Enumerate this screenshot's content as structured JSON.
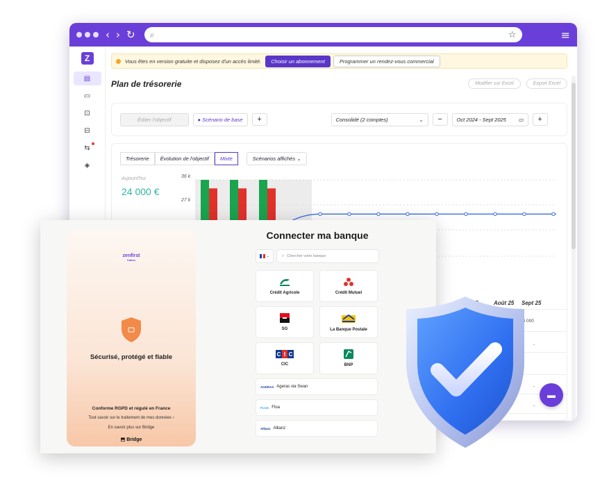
{
  "browser": {
    "url": "",
    "search_icon": "search-icon",
    "back_icon": "chevron-left-icon",
    "forward_icon": "chevron-right-icon",
    "reload_icon": "reload-icon",
    "star_icon": "star-icon",
    "menu_icon": "hamburger-icon"
  },
  "app": {
    "logo": "Z",
    "sidebar": [
      {
        "icon": "table-icon",
        "glyph": "▤",
        "active": true
      },
      {
        "icon": "calendar-icon",
        "glyph": "▭",
        "active": false
      },
      {
        "icon": "document-add-icon",
        "glyph": "⊡",
        "active": false
      },
      {
        "icon": "document-icon",
        "glyph": "⊟",
        "active": false
      },
      {
        "icon": "transfer-icon",
        "glyph": "⇆",
        "active": false,
        "badge": true
      },
      {
        "icon": "tag-icon",
        "glyph": "◈",
        "active": false
      }
    ],
    "banner": {
      "text": "Vous êtes en version gratuite et disposez d'un accès limité.",
      "cta_primary": "Choisir un abonnement",
      "cta_secondary": "Programmer un rendez-vous commercial"
    },
    "page_title": "Plan de trésorerie",
    "head_buttons": [
      "Modifier sur Excel",
      "Export Excel"
    ],
    "toolbar": {
      "edit_goal": "Éditer l'objectif",
      "scenario": "Scénario de base",
      "add": "+",
      "consolidated": "Consolidé (2 comptes)",
      "minus": "−",
      "period": "Oct 2024 - Sept 2025",
      "plus": "+"
    },
    "chart": {
      "tabs": [
        "Trésorerie",
        "Évolution de l'objectif",
        "Mixte"
      ],
      "active_tab": "Mixte",
      "scenarios_dropdown": "Scénarios affichés",
      "today_label": "Aujourd'hui",
      "today_value": "24 000 €",
      "y_ticks": [
        "36 k",
        "27 k"
      ],
      "months_visible": [
        "25",
        "il 25",
        "Août 25",
        "Sept 25"
      ],
      "table_value": "24 000",
      "table_dash": "-",
      "colors": {
        "green": "#1aa44f",
        "red": "#e0312b",
        "line": "#3b6fe0"
      }
    }
  },
  "chart_data": {
    "type": "bar",
    "categories": [
      "",
      "",
      ""
    ],
    "series": [
      {
        "values": [
          36,
          36,
          36
        ]
      },
      {
        "values": [
          33,
          33,
          33
        ]
      }
    ],
    "line_values": [
      24,
      24,
      24,
      24,
      24,
      24,
      24,
      24,
      24,
      24
    ],
    "ylim": [
      0,
      36
    ],
    "y_ticks": [
      "36 k",
      "27 k"
    ]
  },
  "modal": {
    "brand": "zenfirst",
    "brand_sub": "Cabos",
    "secure_title": "Sécurisé, protégé et fiable",
    "rgpd": "Conforme RGPD et régulé en France",
    "know_more": "Tout savoir sur le traitement de mes données",
    "bridge_more": "En savoir plus sur Bridge",
    "bridge_logo": "Bridge",
    "title": "Connecter ma banque",
    "search_placeholder": "Chercher votre banque",
    "banks_grid": [
      {
        "name": "Crédit Agricole",
        "icon": "credit-agricole-logo"
      },
      {
        "name": "Crédit Mutuel",
        "icon": "credit-mutuel-logo"
      },
      {
        "name": "SG",
        "icon": "sg-logo"
      },
      {
        "name": "La Banque Postale",
        "icon": "banque-postale-logo"
      },
      {
        "name": "CIC",
        "icon": "cic-logo"
      },
      {
        "name": "BNP",
        "icon": "bnp-logo"
      }
    ],
    "banks_list": [
      {
        "name": "Ageras via Swan",
        "logo_text": "AGERAS"
      },
      {
        "name": "Floa",
        "logo_text": "FLOA"
      },
      {
        "name": "Allianz",
        "logo_text": "Allianz"
      }
    ]
  }
}
